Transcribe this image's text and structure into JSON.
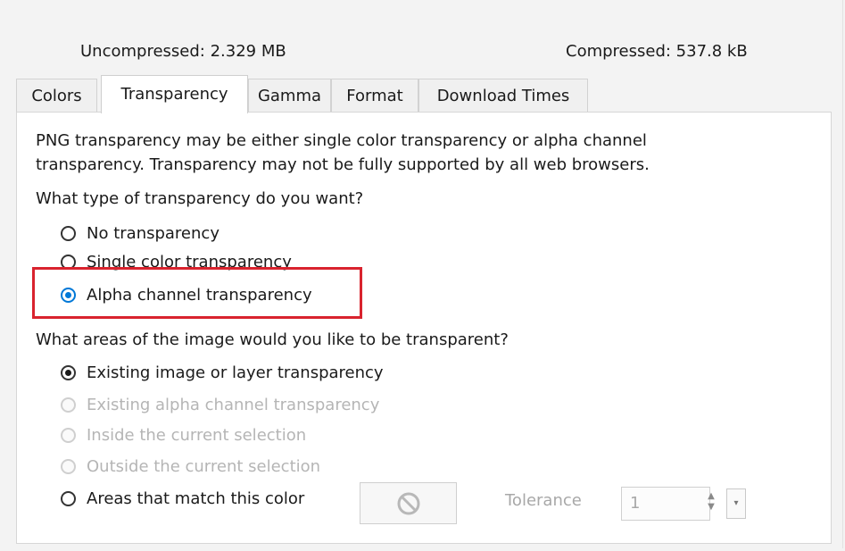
{
  "header": {
    "uncompressed": "Uncompressed:  2.329 MB",
    "compressed": "Compressed: 537.8 kB"
  },
  "tabs": [
    {
      "label": "Colors"
    },
    {
      "label": "Transparency",
      "active": true
    },
    {
      "label": "Gamma"
    },
    {
      "label": "Format"
    },
    {
      "label": "Download Times"
    }
  ],
  "panel": {
    "description_line1": "PNG transparency may be either single color transparency or alpha channel",
    "description_line2": "transparency. Transparency may not be fully supported by all web browsers.",
    "type_question": "What type of transparency do you want?",
    "type_options": [
      {
        "label": "No transparency",
        "selected": false
      },
      {
        "label": "Single color transparency",
        "selected": false
      },
      {
        "label": "Alpha channel transparency",
        "selected": true
      }
    ],
    "area_question": "What areas of the image would you like to be transparent?",
    "area_options": [
      {
        "label": "Existing image or layer transparency",
        "selected": true,
        "enabled": true
      },
      {
        "label": "Existing alpha channel transparency",
        "selected": false,
        "enabled": false
      },
      {
        "label": "Inside the current selection",
        "selected": false,
        "enabled": false
      },
      {
        "label": "Outside the current selection",
        "selected": false,
        "enabled": false
      },
      {
        "label": "Areas that match this color",
        "selected": false,
        "enabled": true
      }
    ],
    "tolerance_label": "Tolerance",
    "tolerance_value": "1"
  },
  "colors": {
    "highlight": "#d9232e",
    "radio_accent": "#0078d7"
  }
}
